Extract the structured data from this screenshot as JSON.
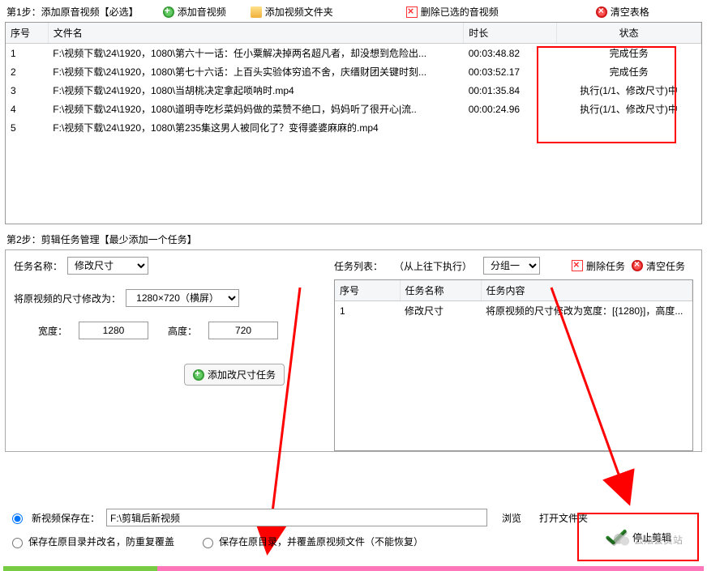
{
  "toolbar_top": {
    "step1_label": "第1步：添加原音视频【必选】",
    "add_av": "添加音视频",
    "add_folder": "添加视频文件夹",
    "del_selected": "删除已选的音视频",
    "clear_table": "清空表格"
  },
  "table": {
    "headers": {
      "seq": "序号",
      "name": "文件名",
      "dur": "时长",
      "status": "状态"
    },
    "rows": [
      {
        "seq": "1",
        "name": "F:\\视频下载\\24\\1920，1080\\第六十一话：任小粟解决掉两名超凡者，却没想到危险出...",
        "dur": "00:03:48.82",
        "status": "完成任务"
      },
      {
        "seq": "2",
        "name": "F:\\视频下载\\24\\1920，1080\\第七十六话：上百头实验体穷追不舍，庆缙财团关键时刻...",
        "dur": "00:03:52.17",
        "status": "完成任务"
      },
      {
        "seq": "3",
        "name": "F:\\视频下载\\24\\1920，1080\\当胡桃决定拿起唢呐时.mp4",
        "dur": "00:01:35.84",
        "status": "执行(1/1、修改尺寸)中"
      },
      {
        "seq": "4",
        "name": "F:\\视频下载\\24\\1920，1080\\道明寺吃杉菜妈妈做的菜赞不绝口，妈妈听了很开心|流..",
        "dur": "00:00:24.96",
        "status": "执行(1/1、修改尺寸)中"
      },
      {
        "seq": "5",
        "name": "F:\\视频下载\\24\\1920，1080\\第235集这男人被同化了？变得婆婆麻麻的.mp4",
        "dur": "",
        "status": ""
      }
    ]
  },
  "step2": {
    "label": "第2步：剪辑任务管理【最少添加一个任务】",
    "task_name_label": "任务名称：",
    "task_name_value": "修改尺寸",
    "resize_label": "将原视频的尺寸修改为：",
    "resize_preset": "1280×720（横屏）",
    "width_label": "宽度：",
    "width_value": "1280",
    "height_label": "高度：",
    "height_value": "720",
    "add_task_btn": "添加改尺寸任务",
    "list_label": "任务列表：",
    "list_hint": "（从上往下执行）",
    "group_value": "分组一",
    "del_task": "删除任务",
    "clear_tasks": "清空任务",
    "task_headers": {
      "seq": "序号",
      "name": "任务名称",
      "content": "任务内容"
    },
    "task_rows": [
      {
        "seq": "1",
        "name": "修改尺寸",
        "content": "将原视频的尺寸修改为宽度：[{1280}]，高度..."
      }
    ]
  },
  "bottom": {
    "save_new_label": "新视频保存在：",
    "save_path": "F:\\剪辑后新视频",
    "browse": "浏览",
    "open_folder": "打开文件夹",
    "save_rename": "保存在原目录并改名，防重复覆盖",
    "save_overwrite": "保存在原目录，并覆盖原视频文件（不能恢复）",
    "stop_btn": "停止剪辑"
  },
  "watermark": "云炫会员站"
}
